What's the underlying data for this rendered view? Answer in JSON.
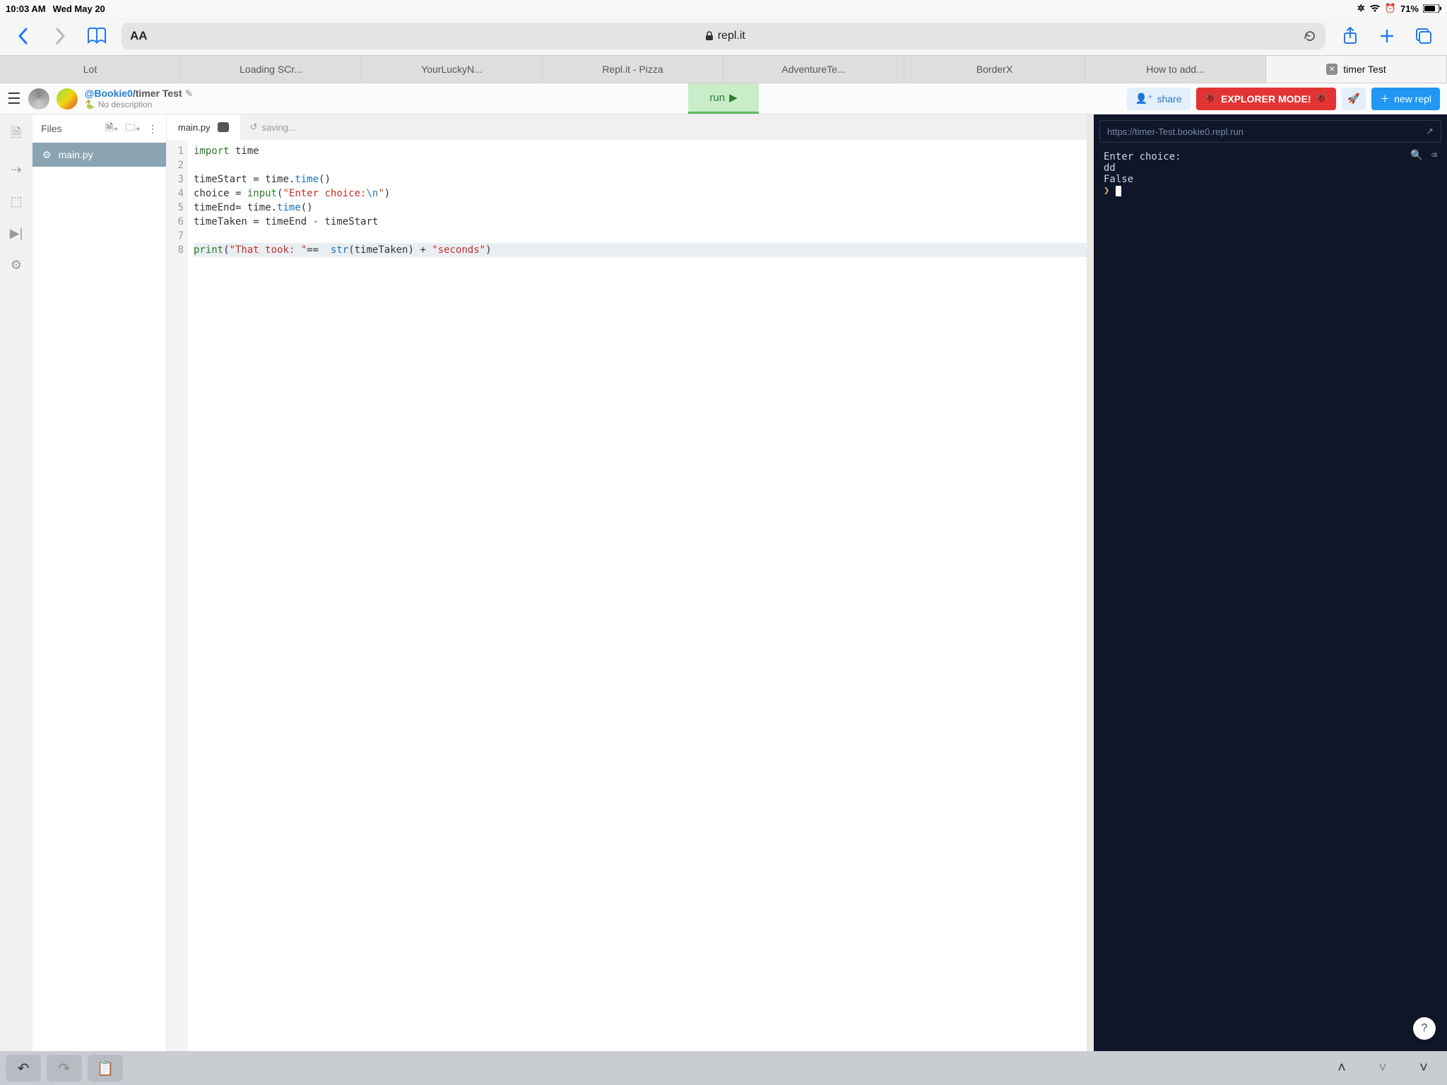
{
  "status": {
    "time": "10:03 AM",
    "date": "Wed May 20",
    "battery": "71%"
  },
  "safari": {
    "url_host": "repl.it",
    "tabs": [
      "Lot",
      "Loading SCr...",
      "YourLuckyN...",
      "Repl.it - Pizza",
      "AdventureTe...",
      "BorderX",
      "How to add...",
      "timer Test"
    ]
  },
  "repl": {
    "owner": "@Bookie0",
    "slash": "/",
    "name": "timer Test",
    "subtitle": "No description",
    "run_label": "run",
    "share_label": "share",
    "explorer_label": "EXPLORER MODE!",
    "new_label": "new repl"
  },
  "files": {
    "header": "Files",
    "items": [
      "main.py"
    ]
  },
  "editor": {
    "tab": "main.py",
    "saving": "saving...",
    "line_numbers": [
      "1",
      "2",
      "3",
      "4",
      "5",
      "6",
      "7",
      "8"
    ],
    "code": {
      "l1a": "import",
      "l1b": " time",
      "l3a": "timeStart ",
      "l3b": "=",
      "l3c": " time.",
      "l3d": "time",
      "l3e": "()",
      "l4a": "choice ",
      "l4b": "=",
      "l4c": " input",
      "l4d": "(",
      "l4e": "\"Enter choice:",
      "l4f": "\\n",
      "l4g": "\"",
      "l4h": ")",
      "l5a": "timeEnd",
      "l5b": "=",
      "l5c": " time.",
      "l5d": "time",
      "l5e": "()",
      "l6a": "timeTaken ",
      "l6b": "=",
      "l6c": " timeEnd ",
      "l6d": "-",
      "l6e": " timeStart",
      "l8a": "print",
      "l8b": "(",
      "l8c": "\"That took: \"",
      "l8d": "==",
      "l8e": "  str",
      "l8f": "(timeTaken) ",
      "l8g": "+",
      "l8h": " ",
      "l8i": "\"seconds\"",
      "l8j": ")"
    }
  },
  "console": {
    "url": "https://timer-Test.bookie0.repl.run",
    "lines": [
      "Enter choice:",
      "dd",
      "False"
    ],
    "prompt": "❯"
  },
  "help": "?"
}
